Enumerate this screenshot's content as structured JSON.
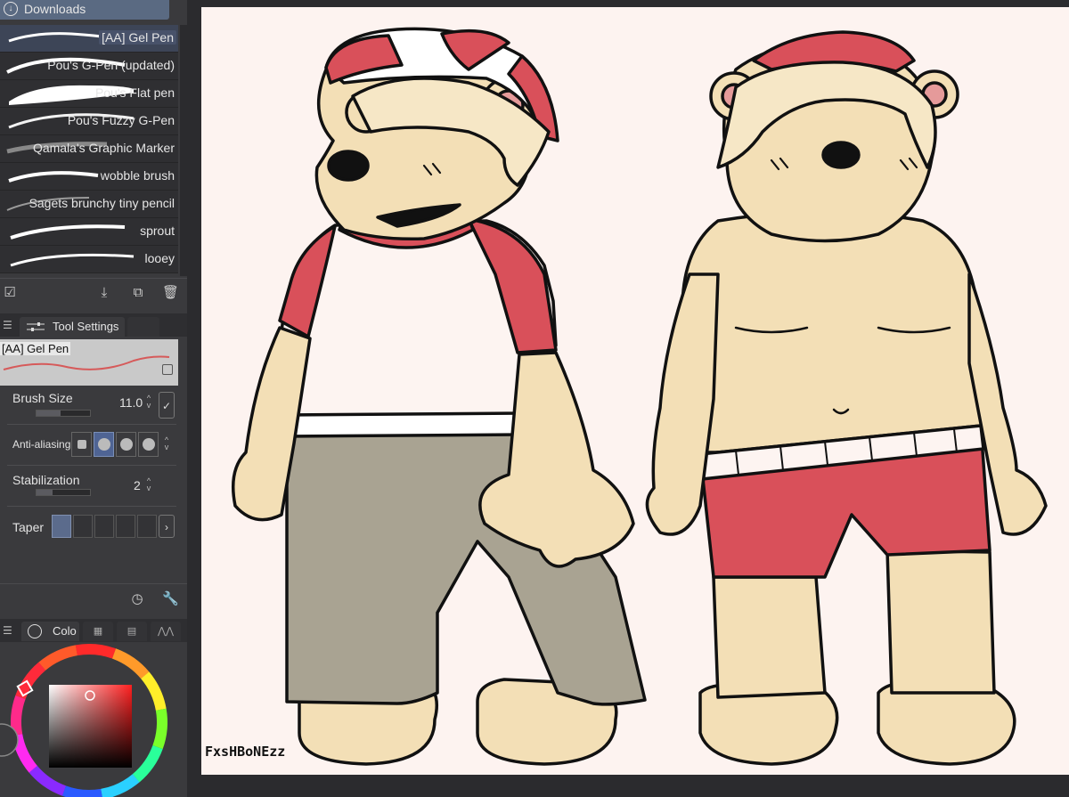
{
  "downloads_tab": {
    "label": "Downloads",
    "icon": "download-icon"
  },
  "brushes": [
    {
      "label": "[AA] Gel Pen",
      "selected": true
    },
    {
      "label": "Pou's G-Pen (updated)",
      "selected": false
    },
    {
      "label": "Pou's Flat pen",
      "selected": false
    },
    {
      "label": "Pou's Fuzzy G-Pen",
      "selected": false
    },
    {
      "label": "Qamala's Graphic Marker",
      "selected": false
    },
    {
      "label": "wobble brush",
      "selected": false
    },
    {
      "label": "Sagets brunchy tiny pencil",
      "selected": false
    },
    {
      "label": "sprout",
      "selected": false
    },
    {
      "label": "looey",
      "selected": false
    }
  ],
  "list_toolbar": {
    "icons": [
      "select-all-icon",
      "import-icon",
      "duplicate-icon",
      "trash-icon"
    ]
  },
  "tool_settings": {
    "tab_label": "Tool Settings",
    "preview_name": "[AA] Gel Pen",
    "brush_size": {
      "label": "Brush Size",
      "value": "11.0",
      "level": 0.45
    },
    "anti_aliasing": {
      "label": "Anti-aliasing",
      "options": 4,
      "selected_index": 1
    },
    "stabilization": {
      "label": "Stabilization",
      "value": "2",
      "level": 0.3
    },
    "taper": {
      "label": "Taper",
      "boxes": 5,
      "selected_index": 0
    },
    "bottom_icons": [
      "time-icon",
      "wrench-icon"
    ]
  },
  "color_panel": {
    "tab_label": "Colo",
    "current_color": "#d63a3a",
    "icons": [
      "color-circle-icon",
      "color-set-icon",
      "palette-history-icon",
      "intermediate-color-icon"
    ]
  },
  "canvas": {
    "signature": "FxsHBoNEzz",
    "colors": {
      "paper": "#fdf3f0",
      "fur": "#f3dfb6",
      "red": "#d9505a",
      "pants": "#a9a392",
      "ink": "#111111"
    }
  }
}
